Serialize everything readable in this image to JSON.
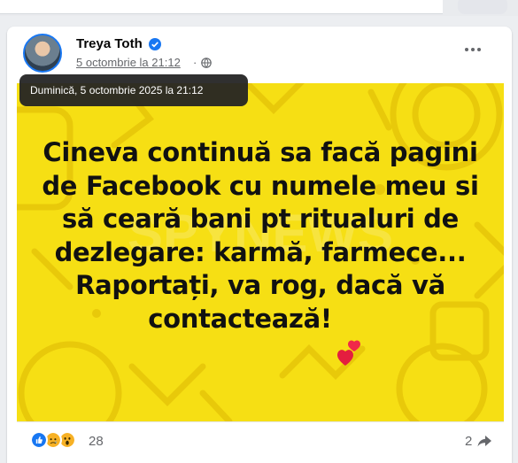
{
  "post": {
    "author": "Treya Toth",
    "date": "5 octombrie la 21:12",
    "separator": "·",
    "tooltip_full_date": "Duminică, 5 octombrie 2025 la 21:12",
    "image_text_lines": [
      "Cineva continuă sa facă pagini",
      "de Facebook cu numele meu si",
      "să ceară bani pt ritualuri de",
      "dezlegare: karmă, farmece...",
      "Raportați, va rog, dacă vă",
      "contactează!"
    ],
    "image_background_color": "#f6df14",
    "reaction_count": "28",
    "reactions": [
      "like-icon",
      "sad-icon",
      "wow-icon"
    ],
    "share_count": "2",
    "icons": {
      "verified": "verified-badge-icon",
      "privacy": "globe-icon",
      "more": "more-options-icon",
      "share": "share-icon",
      "emoji": "two-hearts-icon"
    },
    "accent_color": "#1877f2"
  }
}
